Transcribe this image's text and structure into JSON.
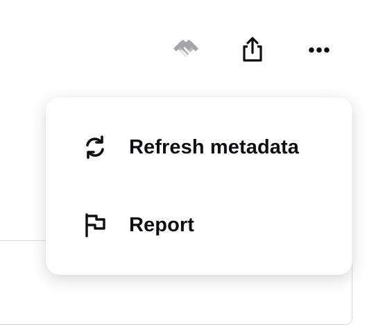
{
  "toolbar": {
    "buttons": [
      {
        "icon": "handshake-icon",
        "color": "#a3a4a8"
      },
      {
        "icon": "share-icon",
        "color": "#0d0f12"
      },
      {
        "icon": "more-horizontal-icon",
        "color": "#0d0f12"
      }
    ]
  },
  "menu": {
    "items": [
      {
        "label": "Refresh metadata",
        "icon": "refresh-icon"
      },
      {
        "label": "Report",
        "icon": "flag-icon"
      }
    ]
  },
  "colors": {
    "text": "#0d0f12",
    "muted_icon": "#a3a4a8",
    "menu_background": "#ffffff",
    "border": "#d9d9dc"
  }
}
